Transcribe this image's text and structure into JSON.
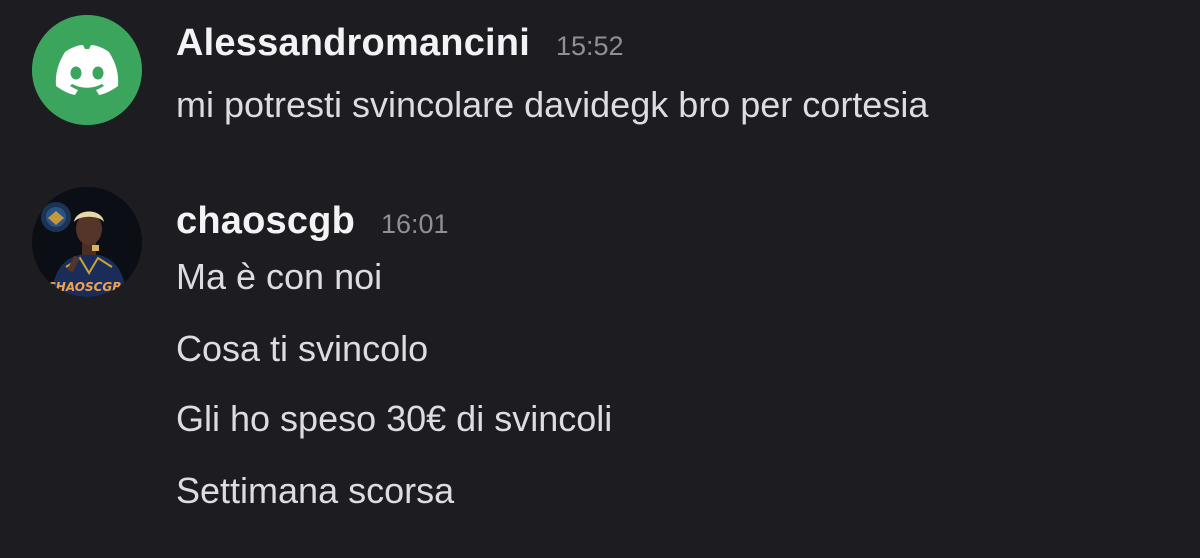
{
  "messages": [
    {
      "author": "Alessandromancini",
      "time": "15:52",
      "avatar_icon": "discord-logo-icon",
      "avatar_color": "#3ba55d",
      "lines": [
        "mi potresti svincolare davidegk bro per cortesia"
      ]
    },
    {
      "author": "chaoscgb",
      "time": "16:01",
      "avatar_icon": "profile-photo",
      "avatar_text": "CHAOSCGB",
      "lines": [
        "Ma è con noi",
        "Cosa ti svincolo",
        "Gli ho speso 30€ di svincoli",
        "Settimana scorsa"
      ]
    }
  ],
  "colors": {
    "background": "#1c1c21",
    "author": "#f2f3f5",
    "timestamp": "#8e9099",
    "message_text": "#dcdde1",
    "avatar_discord_green": "#3ba55d"
  }
}
